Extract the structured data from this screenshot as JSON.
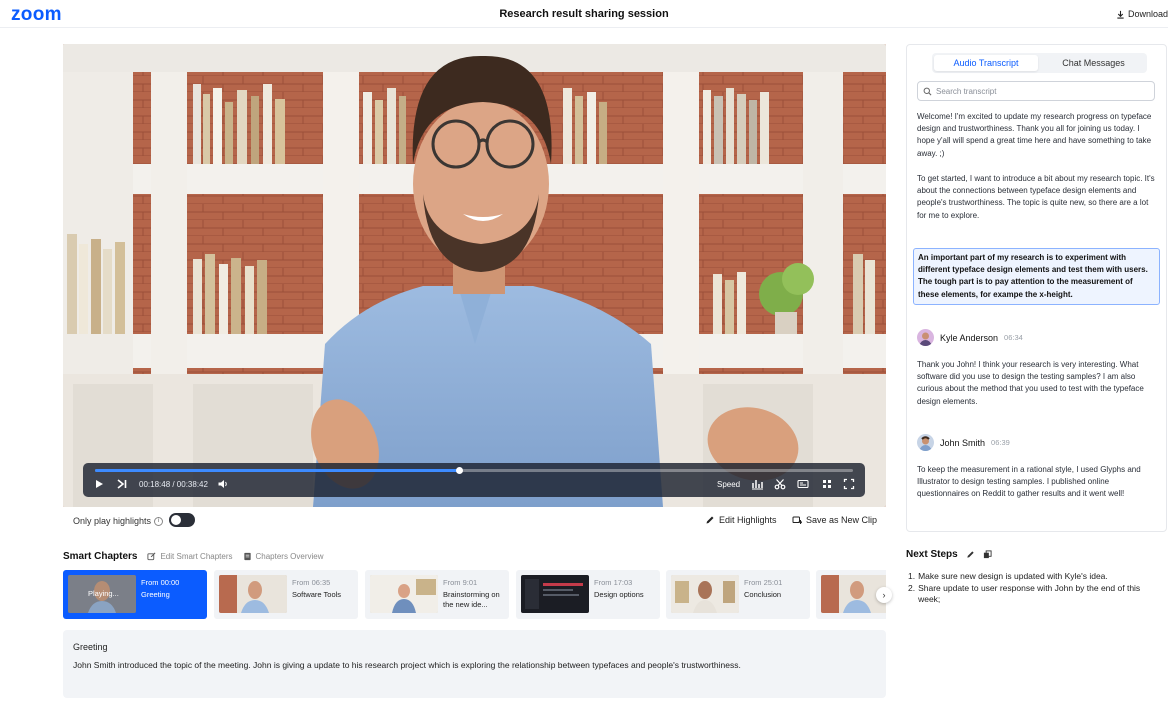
{
  "app": {
    "logo": "zoom",
    "title": "Research result sharing session",
    "download_label": "Download"
  },
  "player": {
    "progress": 0.48,
    "timecode": "00:18:48 / 00:38:42",
    "speed_label": "Speed"
  },
  "toolbar": {
    "only_highlights_label": "Only play highlights",
    "edit_highlights_label": "Edit Highlights",
    "save_clip_label": "Save as New Clip"
  },
  "chapters": {
    "title": "Smart Chapters",
    "edit_label": "Edit Smart Chapters",
    "overview_label": "Chapters Overview",
    "playing_label": "Playing...",
    "items": [
      {
        "from": "From 00:00",
        "name": "Greeting"
      },
      {
        "from": "From 06:35",
        "name": "Software Tools"
      },
      {
        "from": "From 9:01",
        "name": "Brainstorming on the new ide..."
      },
      {
        "from": "From 17:03",
        "name": "Design options"
      },
      {
        "from": "From 25:01",
        "name": "Conclusion"
      }
    ]
  },
  "summary": {
    "title": "Greeting",
    "text": "John Smith introduced the topic of the meeting. John is giving a  update to his research project which is exploring the relationship between typefaces and people's trustworthiness."
  },
  "transcript": {
    "tab_transcript": "Audio Transcript",
    "tab_chat": "Chat Messages",
    "search_placeholder": "Search transcript",
    "p1": "Welcome! I'm excited to update my research progress on typeface design and trustworthiness. Thank you all for joining us today. I hope y'all will spend a great time here and have something to take away. ;)",
    "p2": "To get started, I want to introduce a bit about my research topic. It's about the connections between typeface design elements and people's trustworthiness. The topic is quite new, so there are a lot for me to explore.",
    "p3": "An important part of my research is to experiment with different typeface design elements and test them with users. The tough part is to pay attention to the measurement of these elements, for exampe the x-height.",
    "speaker1": {
      "name": "Kyle Anderson",
      "time": "06:34"
    },
    "p4": "Thank you John! I think your research is very interesting. What software did you use to design the testing samples? I am also curious about the method that you used to test with the typeface design elements.",
    "speaker2": {
      "name": "John Smith",
      "time": "06:39"
    },
    "p5": "To keep the measurement in a rational style, I used Glyphs and Illustrator to design testing samples. I published online questionnaires on Reddit to gather results and it went well!"
  },
  "next_steps": {
    "title": "Next Steps",
    "items": [
      {
        "num": "1.",
        "text": "Make sure new design is updated with Kyle's idea."
      },
      {
        "num": "2.",
        "text": "Share update to user response with John by the end of this week;"
      }
    ]
  }
}
